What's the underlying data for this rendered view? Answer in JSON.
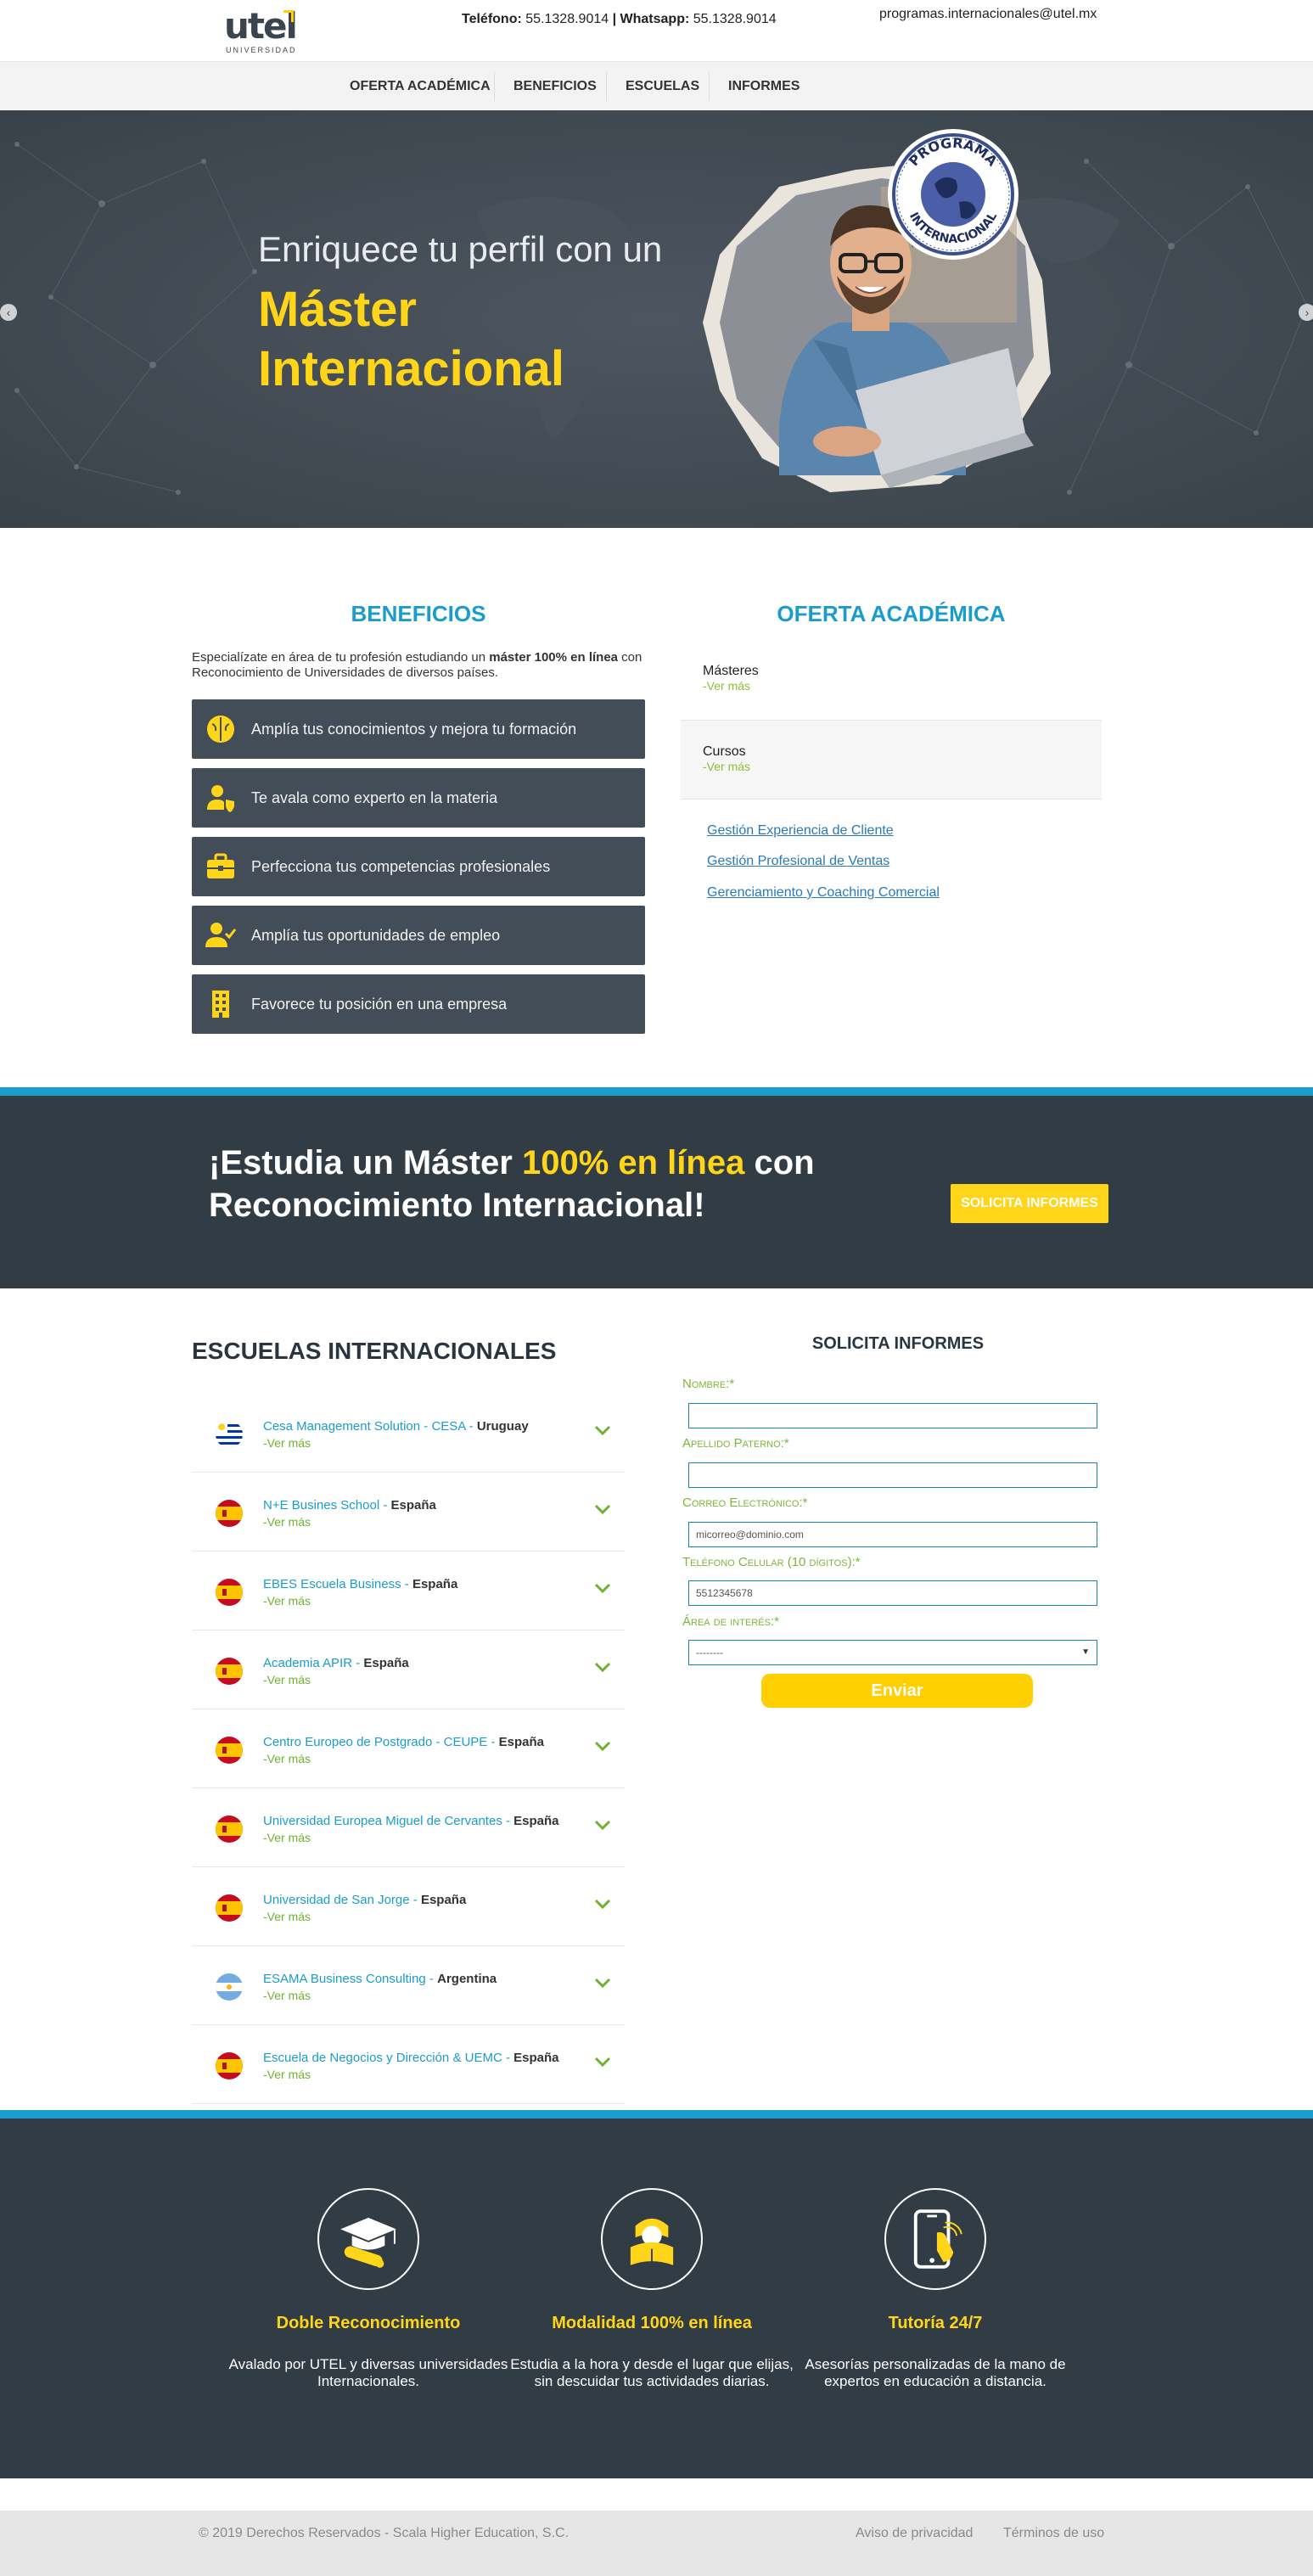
{
  "header": {
    "logo_text": "utel",
    "logo_subtitle": "UNIVERSIDAD",
    "phone_label": "Teléfono:",
    "phone_value": "55.1328.9014",
    "separator": "|",
    "whatsapp_label": "Whatsapp:",
    "whatsapp_value": "55.1328.9014",
    "email": "programas.internacionales@utel.mx"
  },
  "nav": {
    "items": [
      "OFERTA ACADÉMICA",
      "BENEFICIOS",
      "ESCUELAS",
      "INFORMES"
    ]
  },
  "hero": {
    "line1": "Enriquece tu perfil con un",
    "line2": "Máster Internacional",
    "badge_top": "PROGRAMA",
    "badge_bottom": "INTERNACIONAL",
    "prev_arrow": "‹",
    "next_arrow": "›"
  },
  "benefits": {
    "title": "BENEFICIOS",
    "intro_before": "Especialízate en área de tu profesión estudiando un ",
    "intro_bold": "máster 100% en línea",
    "intro_after": " con Reconocimiento de Universidades de diversos países.",
    "items": [
      {
        "label": "Amplía tus conocimientos y mejora tu formación",
        "icon": "brain-icon"
      },
      {
        "label": "Te avala como experto en la materia",
        "icon": "user-shield-icon"
      },
      {
        "label": "Perfecciona tus competencias profesionales",
        "icon": "briefcase-icon"
      },
      {
        "label": "Amplía tus oportunidades de empleo",
        "icon": "user-check-icon"
      },
      {
        "label": "Favorece tu posición en una empresa",
        "icon": "building-icon"
      }
    ]
  },
  "oferta": {
    "title": "OFERTA ACADÉMICA",
    "categories": [
      {
        "name": "Másteres",
        "more": "-Ver más"
      },
      {
        "name": "Cursos",
        "more": "-Ver más"
      }
    ],
    "links": [
      "Gestión Experiencia de Cliente",
      "Gestión Profesional de Ventas",
      "Gerenciamiento y Coaching Comercial"
    ]
  },
  "banner": {
    "text_before": "¡Estudia un Máster ",
    "text_highlight": "100% en línea",
    "text_after": " con Reconocimiento Internacional!",
    "button": "SOLICITA INFORMES"
  },
  "schools": {
    "title": "ESCUELAS INTERNACIONALES",
    "items": [
      {
        "name": "Cesa Management Solution - CESA",
        "country": "Uruguay",
        "flag": "uruguay",
        "more": "-Ver más"
      },
      {
        "name": "N+E Busines School",
        "country": "España",
        "flag": "spain",
        "more": "-Ver más"
      },
      {
        "name": "EBES Escuela Business",
        "country": "España",
        "flag": "spain",
        "more": "-Ver más"
      },
      {
        "name": "Academia APIR",
        "country": "España",
        "flag": "spain",
        "more": "-Ver más"
      },
      {
        "name": "Centro Europeo de Postgrado - CEUPE",
        "country": "España",
        "flag": "spain",
        "more": "-Ver más"
      },
      {
        "name": "Universidad Europea Miguel de Cervantes",
        "country": "España",
        "flag": "spain",
        "more": "-Ver más"
      },
      {
        "name": "Universidad de San Jorge",
        "country": "España",
        "flag": "spain",
        "more": "-Ver más"
      },
      {
        "name": "ESAMA Business Consulting",
        "country": "Argentina",
        "flag": "argentina",
        "more": "-Ver más"
      },
      {
        "name": "Escuela de Negocios y Dirección & UEMC",
        "country": "España",
        "flag": "spain",
        "more": "-Ver más"
      }
    ],
    "dash": " - "
  },
  "form": {
    "title": "SOLICITA INFORMES",
    "fields": [
      {
        "label": "Nombre:*",
        "value": ""
      },
      {
        "label": "Apellido Paterno:*",
        "value": ""
      },
      {
        "label": "Correo Electrónico:*",
        "value": "micorreo@dominio.com"
      },
      {
        "label": "Teléfono Celular (10 dígitos):*",
        "value": "5512345678"
      }
    ],
    "select_label": "Área de interés:*",
    "select_value": "--------",
    "submit": "Enviar"
  },
  "features": [
    {
      "title": "Doble Reconocimiento",
      "desc": "Avalado por UTEL y diversas universidades Internacionales.",
      "icon": "graduation-diploma-icon"
    },
    {
      "title": "Modalidad 100% en línea",
      "desc": "Estudia a la hora y desde el lugar que elijas, sin descuidar tus actividades diarias.",
      "icon": "student-reading-icon"
    },
    {
      "title": "Tutoría 24/7",
      "desc": "Asesorías personalizadas de la mano de expertos en educación a distancia.",
      "icon": "mobile-touch-icon"
    }
  ],
  "footer": {
    "copyright": "© 2019 Derechos Reservados - Scala Higher Education, S.C.",
    "privacy": "Aviso de privacidad",
    "terms": "Términos de uso"
  },
  "colors": {
    "accent_blue": "#1a9ccc",
    "accent_yellow": "#ffd51a",
    "dark": "#323c45",
    "green": "#6fb232"
  }
}
